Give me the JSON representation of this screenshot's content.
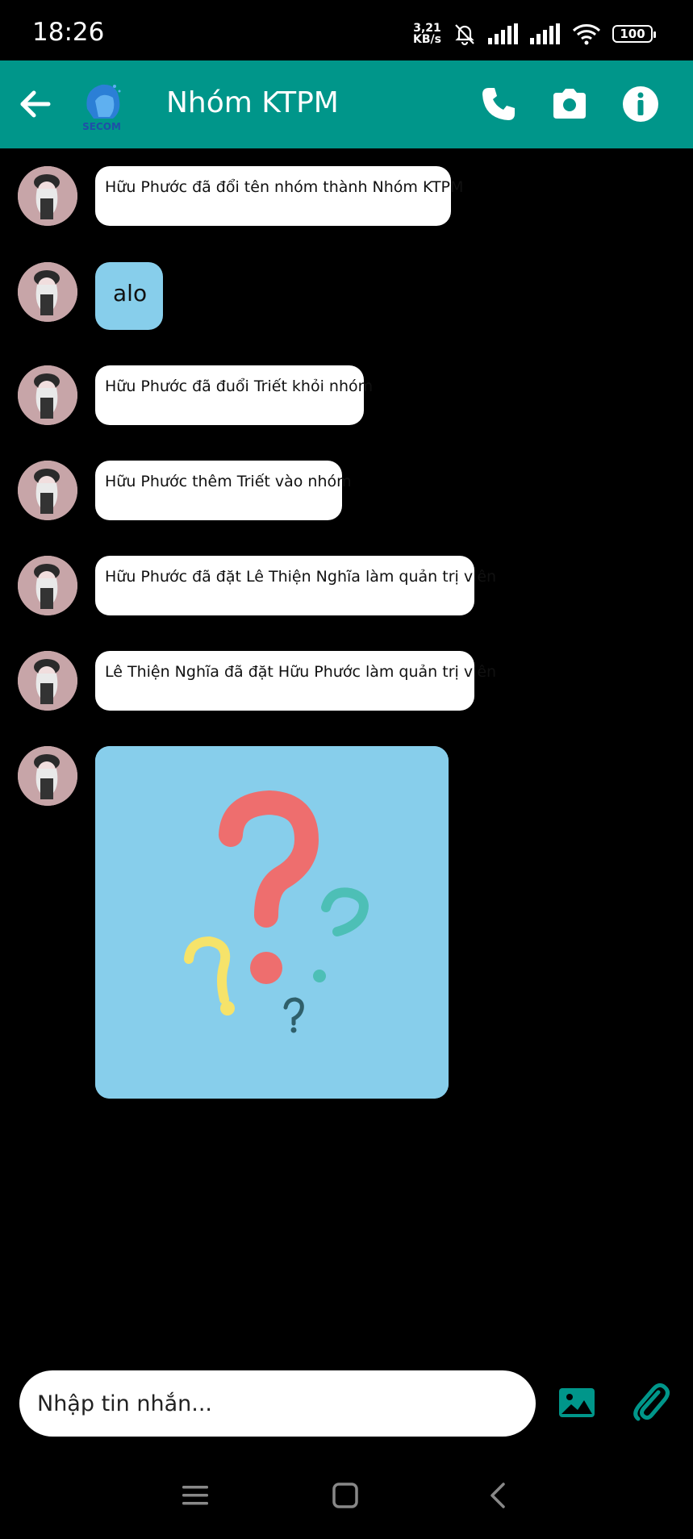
{
  "status_bar": {
    "time": "18:26",
    "net_speed_value": "3,21",
    "net_speed_unit": "KB/s",
    "battery": "100"
  },
  "header": {
    "title": "Nhóm KTPM",
    "logo_text": "SECOM"
  },
  "messages": [
    {
      "type": "system",
      "text": "Hữu Phước đã đổi tên nhóm thành Nhóm KTPM"
    },
    {
      "type": "text",
      "text": "alo"
    },
    {
      "type": "system",
      "text": "Hữu Phước đã đuổi Triết khỏi nhóm"
    },
    {
      "type": "system",
      "text": "Hữu Phước thêm Triết vào nhóm"
    },
    {
      "type": "system",
      "text": "Hữu Phước đã đặt Lê Thiện Nghĩa làm quản trị viên"
    },
    {
      "type": "system",
      "text": "Lê Thiện Nghĩa đã đặt Hữu Phước làm quản trị viên"
    },
    {
      "type": "image",
      "icon": "question-marks-image"
    }
  ],
  "composer": {
    "placeholder": "Nhập tin nhắn..."
  },
  "colors": {
    "header": "#00968a",
    "bubble_blue": "#87ceeb",
    "bubble_white": "#ffffff",
    "background": "#000000"
  }
}
